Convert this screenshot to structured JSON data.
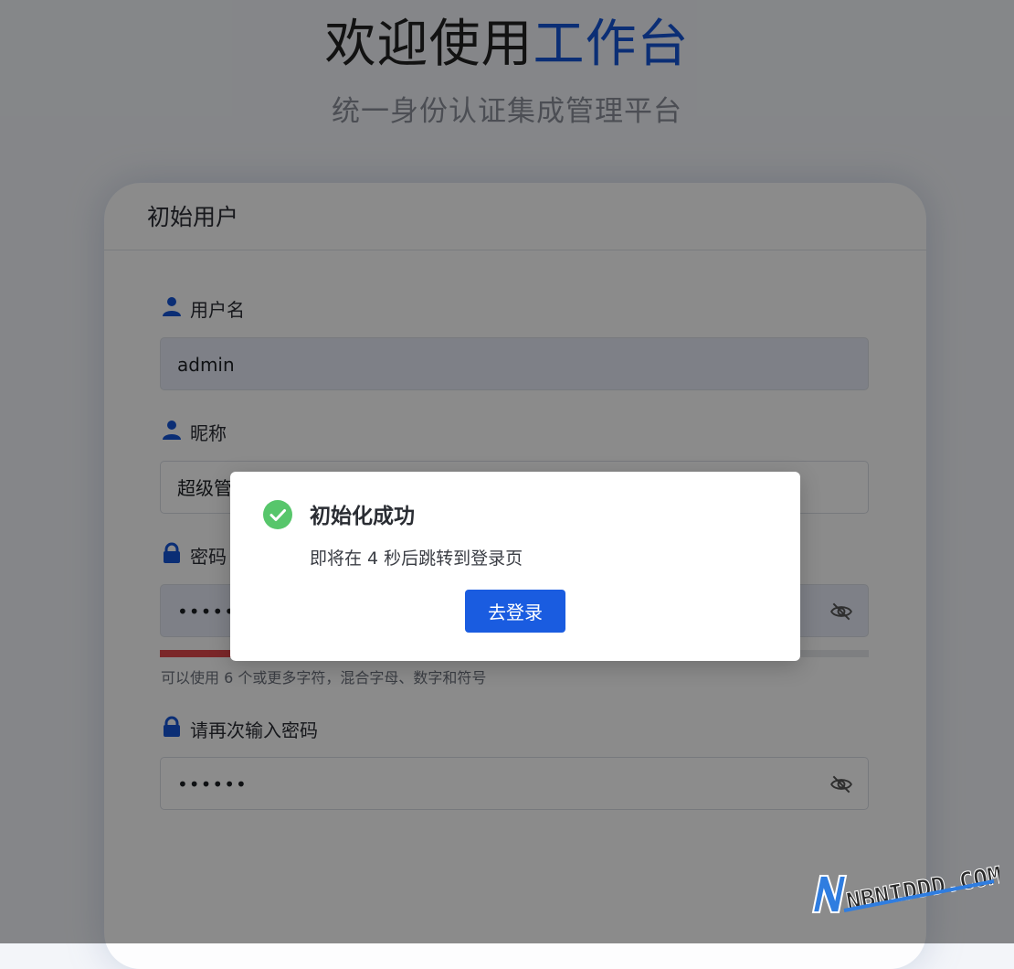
{
  "header": {
    "title_main": "欢迎使用",
    "title_accent": "工作台",
    "subtitle": "统一身份认证集成管理平台"
  },
  "card": {
    "title": "初始用户"
  },
  "form": {
    "username": {
      "label": "用户名",
      "value": "admin"
    },
    "nickname": {
      "label": "昵称",
      "value": "超级管"
    },
    "password": {
      "label": "密码",
      "value": "••••••",
      "strength_fraction": 0.1
    },
    "password_hint": "可以使用 6 个或更多字符，混合字母、数字和符号",
    "confirm": {
      "label": "请再次输入密码",
      "value": "••••••"
    }
  },
  "dialog": {
    "title": "初始化成功",
    "message": "即将在 4 秒后跳转到登录页",
    "button": "去登录"
  },
  "watermark": {
    "text": "NBNIDDD.COM"
  },
  "colors": {
    "accent": "#1454d6",
    "primary_button": "#1a5ce0",
    "success": "#52c41a",
    "strength_weak": "#e0474c"
  },
  "icons": [
    "user-icon",
    "lock-icon",
    "eye-off-icon",
    "check-circle-icon"
  ]
}
